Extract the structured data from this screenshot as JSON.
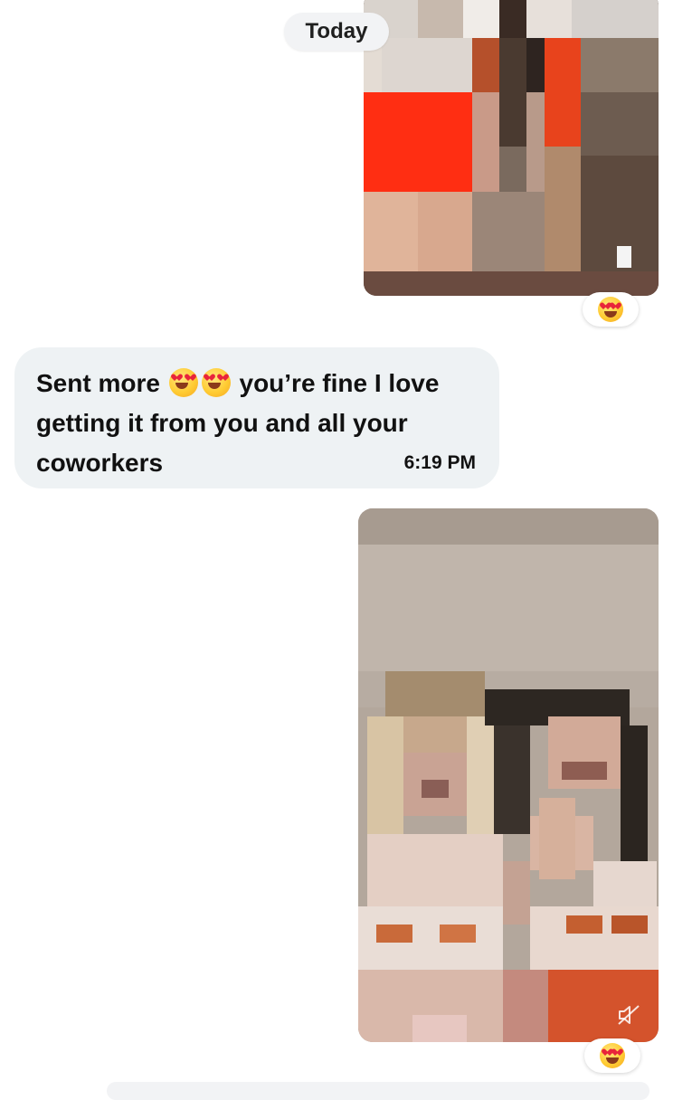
{
  "date_separator": "Today",
  "messages": [
    {
      "type": "image",
      "reaction": "heart-eyes-emoji"
    },
    {
      "type": "text",
      "text_before": "Sent more",
      "text_after": "you’re fine I love getting it from you and all your coworkers",
      "emojis": [
        "heart-eyes-emoji",
        "heart-eyes-emoji"
      ],
      "time": "6:19 PM"
    },
    {
      "type": "video",
      "icons": [
        "muted-speaker-icon"
      ],
      "reaction": "heart-eyes-emoji"
    }
  ],
  "colors": {
    "bubble_bg": "#eef2f4",
    "pill_bg": "#f2f3f5",
    "text": "#111111"
  }
}
